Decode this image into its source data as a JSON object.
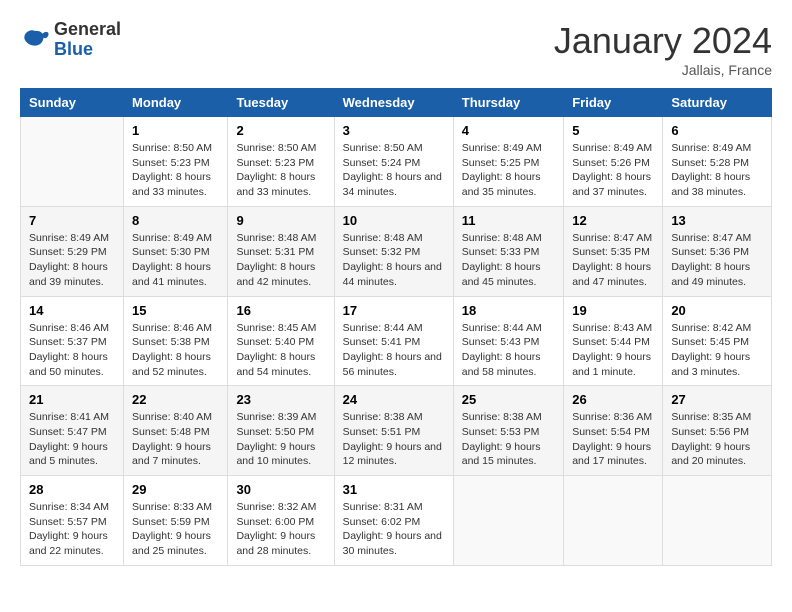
{
  "logo": {
    "text_general": "General",
    "text_blue": "Blue"
  },
  "header": {
    "month_year": "January 2024",
    "location": "Jallais, France"
  },
  "weekdays": [
    "Sunday",
    "Monday",
    "Tuesday",
    "Wednesday",
    "Thursday",
    "Friday",
    "Saturday"
  ],
  "weeks": [
    [
      {
        "day": "",
        "sunrise": "",
        "sunset": "",
        "daylight": ""
      },
      {
        "day": "1",
        "sunrise": "Sunrise: 8:50 AM",
        "sunset": "Sunset: 5:23 PM",
        "daylight": "Daylight: 8 hours and 33 minutes."
      },
      {
        "day": "2",
        "sunrise": "Sunrise: 8:50 AM",
        "sunset": "Sunset: 5:23 PM",
        "daylight": "Daylight: 8 hours and 33 minutes."
      },
      {
        "day": "3",
        "sunrise": "Sunrise: 8:50 AM",
        "sunset": "Sunset: 5:24 PM",
        "daylight": "Daylight: 8 hours and 34 minutes."
      },
      {
        "day": "4",
        "sunrise": "Sunrise: 8:49 AM",
        "sunset": "Sunset: 5:25 PM",
        "daylight": "Daylight: 8 hours and 35 minutes."
      },
      {
        "day": "5",
        "sunrise": "Sunrise: 8:49 AM",
        "sunset": "Sunset: 5:26 PM",
        "daylight": "Daylight: 8 hours and 37 minutes."
      },
      {
        "day": "6",
        "sunrise": "Sunrise: 8:49 AM",
        "sunset": "Sunset: 5:28 PM",
        "daylight": "Daylight: 8 hours and 38 minutes."
      }
    ],
    [
      {
        "day": "7",
        "sunrise": "Sunrise: 8:49 AM",
        "sunset": "Sunset: 5:29 PM",
        "daylight": "Daylight: 8 hours and 39 minutes."
      },
      {
        "day": "8",
        "sunrise": "Sunrise: 8:49 AM",
        "sunset": "Sunset: 5:30 PM",
        "daylight": "Daylight: 8 hours and 41 minutes."
      },
      {
        "day": "9",
        "sunrise": "Sunrise: 8:48 AM",
        "sunset": "Sunset: 5:31 PM",
        "daylight": "Daylight: 8 hours and 42 minutes."
      },
      {
        "day": "10",
        "sunrise": "Sunrise: 8:48 AM",
        "sunset": "Sunset: 5:32 PM",
        "daylight": "Daylight: 8 hours and 44 minutes."
      },
      {
        "day": "11",
        "sunrise": "Sunrise: 8:48 AM",
        "sunset": "Sunset: 5:33 PM",
        "daylight": "Daylight: 8 hours and 45 minutes."
      },
      {
        "day": "12",
        "sunrise": "Sunrise: 8:47 AM",
        "sunset": "Sunset: 5:35 PM",
        "daylight": "Daylight: 8 hours and 47 minutes."
      },
      {
        "day": "13",
        "sunrise": "Sunrise: 8:47 AM",
        "sunset": "Sunset: 5:36 PM",
        "daylight": "Daylight: 8 hours and 49 minutes."
      }
    ],
    [
      {
        "day": "14",
        "sunrise": "Sunrise: 8:46 AM",
        "sunset": "Sunset: 5:37 PM",
        "daylight": "Daylight: 8 hours and 50 minutes."
      },
      {
        "day": "15",
        "sunrise": "Sunrise: 8:46 AM",
        "sunset": "Sunset: 5:38 PM",
        "daylight": "Daylight: 8 hours and 52 minutes."
      },
      {
        "day": "16",
        "sunrise": "Sunrise: 8:45 AM",
        "sunset": "Sunset: 5:40 PM",
        "daylight": "Daylight: 8 hours and 54 minutes."
      },
      {
        "day": "17",
        "sunrise": "Sunrise: 8:44 AM",
        "sunset": "Sunset: 5:41 PM",
        "daylight": "Daylight: 8 hours and 56 minutes."
      },
      {
        "day": "18",
        "sunrise": "Sunrise: 8:44 AM",
        "sunset": "Sunset: 5:43 PM",
        "daylight": "Daylight: 8 hours and 58 minutes."
      },
      {
        "day": "19",
        "sunrise": "Sunrise: 8:43 AM",
        "sunset": "Sunset: 5:44 PM",
        "daylight": "Daylight: 9 hours and 1 minute."
      },
      {
        "day": "20",
        "sunrise": "Sunrise: 8:42 AM",
        "sunset": "Sunset: 5:45 PM",
        "daylight": "Daylight: 9 hours and 3 minutes."
      }
    ],
    [
      {
        "day": "21",
        "sunrise": "Sunrise: 8:41 AM",
        "sunset": "Sunset: 5:47 PM",
        "daylight": "Daylight: 9 hours and 5 minutes."
      },
      {
        "day": "22",
        "sunrise": "Sunrise: 8:40 AM",
        "sunset": "Sunset: 5:48 PM",
        "daylight": "Daylight: 9 hours and 7 minutes."
      },
      {
        "day": "23",
        "sunrise": "Sunrise: 8:39 AM",
        "sunset": "Sunset: 5:50 PM",
        "daylight": "Daylight: 9 hours and 10 minutes."
      },
      {
        "day": "24",
        "sunrise": "Sunrise: 8:38 AM",
        "sunset": "Sunset: 5:51 PM",
        "daylight": "Daylight: 9 hours and 12 minutes."
      },
      {
        "day": "25",
        "sunrise": "Sunrise: 8:38 AM",
        "sunset": "Sunset: 5:53 PM",
        "daylight": "Daylight: 9 hours and 15 minutes."
      },
      {
        "day": "26",
        "sunrise": "Sunrise: 8:36 AM",
        "sunset": "Sunset: 5:54 PM",
        "daylight": "Daylight: 9 hours and 17 minutes."
      },
      {
        "day": "27",
        "sunrise": "Sunrise: 8:35 AM",
        "sunset": "Sunset: 5:56 PM",
        "daylight": "Daylight: 9 hours and 20 minutes."
      }
    ],
    [
      {
        "day": "28",
        "sunrise": "Sunrise: 8:34 AM",
        "sunset": "Sunset: 5:57 PM",
        "daylight": "Daylight: 9 hours and 22 minutes."
      },
      {
        "day": "29",
        "sunrise": "Sunrise: 8:33 AM",
        "sunset": "Sunset: 5:59 PM",
        "daylight": "Daylight: 9 hours and 25 minutes."
      },
      {
        "day": "30",
        "sunrise": "Sunrise: 8:32 AM",
        "sunset": "Sunset: 6:00 PM",
        "daylight": "Daylight: 9 hours and 28 minutes."
      },
      {
        "day": "31",
        "sunrise": "Sunrise: 8:31 AM",
        "sunset": "Sunset: 6:02 PM",
        "daylight": "Daylight: 9 hours and 30 minutes."
      },
      {
        "day": "",
        "sunrise": "",
        "sunset": "",
        "daylight": ""
      },
      {
        "day": "",
        "sunrise": "",
        "sunset": "",
        "daylight": ""
      },
      {
        "day": "",
        "sunrise": "",
        "sunset": "",
        "daylight": ""
      }
    ]
  ]
}
